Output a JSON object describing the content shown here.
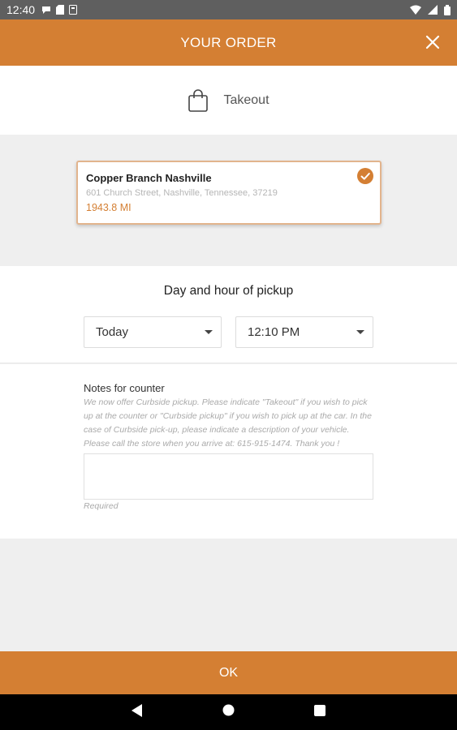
{
  "status_bar": {
    "time": "12:40"
  },
  "header": {
    "title": "YOUR ORDER"
  },
  "order_mode": {
    "label": "Takeout"
  },
  "store": {
    "name": "Copper Branch Nashville",
    "address": "601 Church Street, Nashville, Tennessee, 37219",
    "distance": "1943.8 MI"
  },
  "pickup": {
    "heading": "Day and hour of pickup",
    "day": "Today",
    "time": "12:10 PM"
  },
  "notes": {
    "label": "Notes for counter",
    "help": "We now offer Curbside pickup. Please indicate \"Takeout\" if you wish to pick up at the counter or \"Curbside pickup\" if you wish to pick up at the car. In the case of Curbside pick-up, please indicate a description of your vehicle. Please call the store when you arrive at: 615-915-1474. Thank you !",
    "value": "",
    "required_label": "Required"
  },
  "footer": {
    "ok_label": "OK"
  },
  "colors": {
    "accent": "#d47f33",
    "status_bar": "#5f5f5f",
    "background": "#efefef"
  }
}
